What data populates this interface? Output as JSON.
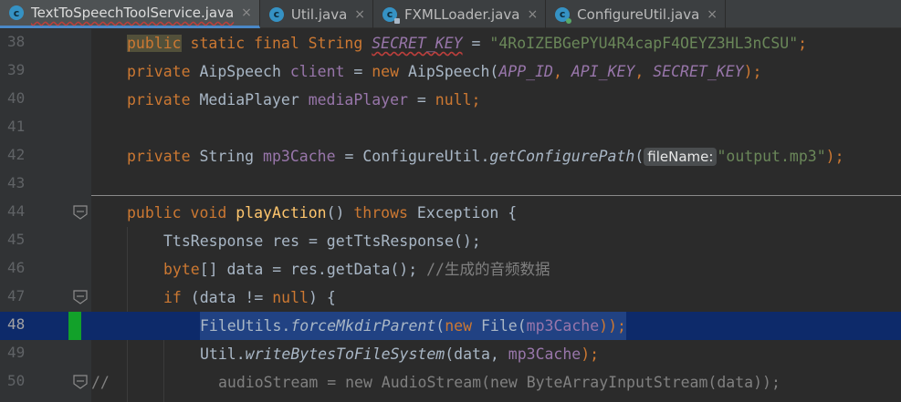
{
  "tabs": [
    {
      "label": "TextToSpeechToolService.java",
      "active": true,
      "close": "×"
    },
    {
      "label": "Util.java",
      "active": false,
      "close": "×"
    },
    {
      "label": "FXMLLoader.java",
      "active": false,
      "close": "×"
    },
    {
      "label": "ConfigureUtil.java",
      "active": false,
      "close": "×"
    }
  ],
  "lines": [
    {
      "num": "38"
    },
    {
      "num": "39"
    },
    {
      "num": "40"
    },
    {
      "num": "41"
    },
    {
      "num": "42"
    },
    {
      "num": "43"
    },
    {
      "num": "44"
    },
    {
      "num": "45"
    },
    {
      "num": "46"
    },
    {
      "num": "47"
    },
    {
      "num": "48"
    },
    {
      "num": "49"
    },
    {
      "num": "50"
    }
  ],
  "code": {
    "l38": {
      "kw": "public",
      "rest": " static final String ",
      "const": "SECRET_KEY",
      "eq": " = ",
      "str": "\"4RoIZEBGePYU4R4capF4OEYZ3HL3nCSU\"",
      "end": ";"
    },
    "l39": {
      "kw": "private",
      "type": " AipSpeech ",
      "fld": "client",
      "eq": " = ",
      "kwnew": "new",
      "ctor": " AipSpeech(",
      "a1": "APP_ID",
      "c1": ", ",
      "a2": "API_KEY",
      "c2": ", ",
      "a3": "SECRET_KEY",
      "end": ");"
    },
    "l40": {
      "kw": "private",
      "type": " MediaPlayer ",
      "fld": "mediaPlayer",
      "eq": " = ",
      "kwnull": "null",
      "end": ";"
    },
    "l42": {
      "kw": "private",
      "type": " String ",
      "fld": "mp3Cache",
      "eq": " = ConfigureUtil.",
      "method": "getConfigurePath",
      "open": "(",
      "hint": "fileName:",
      "str": "\"output.mp3\"",
      "end": ");"
    },
    "l44": {
      "kw": "public void ",
      "name": "playAction",
      "paren": "() ",
      "kwthrows": "throws",
      "rest": " Exception {"
    },
    "l45": {
      "text": "TtsResponse res = getTtsResponse();"
    },
    "l46": {
      "kw": "byte",
      "rest": "[] data = res.getData(); ",
      "comment": "//生成的音频数据"
    },
    "l47": {
      "kw": "if",
      "rest": " (data != ",
      "kwnull": "null",
      "end": ") {"
    },
    "l48": {
      "pre": "FileUtils.",
      "method": "forceMkdirParent",
      "open": "(",
      "kwnew": "new",
      "mid": " File(",
      "fld": "mp3Cache",
      "end": "));"
    },
    "l49": {
      "pre": "Util.",
      "method": "writeBytesToFileSystem",
      "mid": "(data, ",
      "fld": "mp3Cache",
      "end": ");"
    },
    "l50": {
      "slashes": "//",
      "text": "audioStream = new AudioStream(new ByteArrayInputStream(data));"
    }
  }
}
